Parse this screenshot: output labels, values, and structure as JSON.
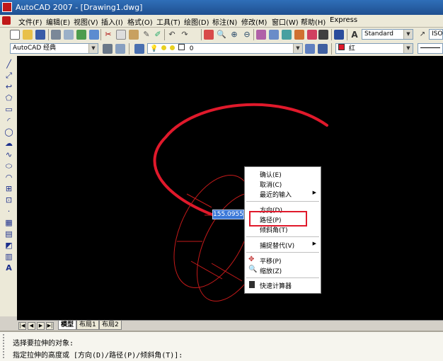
{
  "window": {
    "title": "AutoCAD 2007 - [Drawing1.dwg]"
  },
  "menu": [
    "文件(F)",
    "编辑(E)",
    "视图(V)",
    "插入(I)",
    "格式(O)",
    "工具(T)",
    "绘图(D)",
    "标注(N)",
    "修改(M)",
    "窗口(W)",
    "帮助(H)",
    "Express"
  ],
  "toolbar": {
    "text_style": "Standard",
    "dim_style": "ISO-",
    "workspace": "AutoCAD 经典",
    "layer": "0",
    "color": "红"
  },
  "dynamic_input": {
    "value": "155.0955"
  },
  "context_menu": {
    "items": [
      "确认(E)",
      "取消(C)",
      "最近的输入",
      "方向(D)",
      "路径(P)",
      "倾斜角(T)",
      "捕捉替代(V)",
      "平移(P)",
      "缩放(Z)",
      "快速计算器"
    ],
    "highlighted": "路径(P)"
  },
  "layout_tabs": [
    "模型",
    "布局1",
    "布局2"
  ],
  "command_lines": [
    "选择要拉伸的对象:",
    "指定拉伸的高度或 [方向(D)/路径(P)/倾斜角(T)]:"
  ],
  "colors": {
    "curve": "#e0192b",
    "highlight": "#e0192b",
    "canvas": "#000000"
  }
}
